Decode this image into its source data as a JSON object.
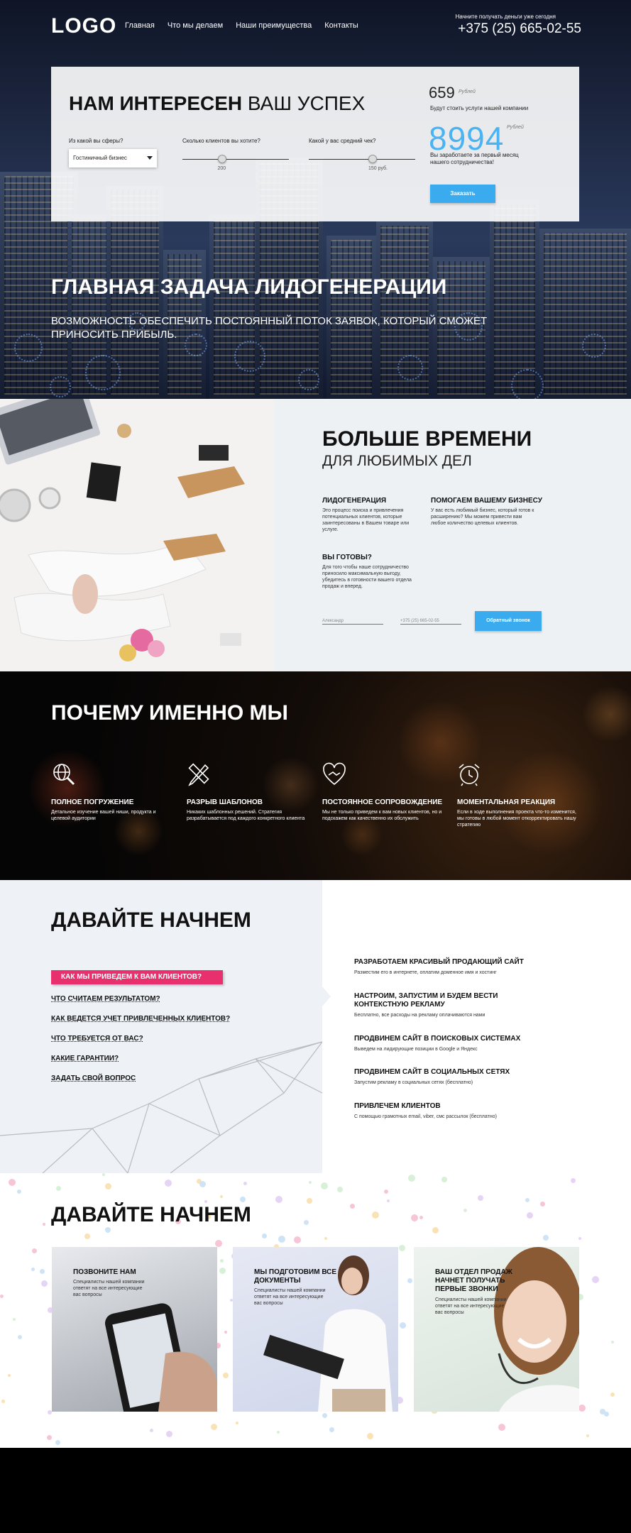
{
  "nav": {
    "logo": "LOGO",
    "links": [
      "Главная",
      "Что мы делаем",
      "Наши преимущества",
      "Контакты"
    ],
    "call_note": "Начните получать деньги уже сегодня",
    "phone": "+375 (25) 665-02-55"
  },
  "calculator": {
    "title_bold": "НАМ ИНТЕРЕСЕН",
    "title_light": "ВАШ УСПЕХ",
    "sphere_label": "Из какой вы сферы?",
    "sphere_value": "Гостиничный бизнес",
    "clients_label": "Сколько клиентов вы хотите?",
    "clients_value": "200",
    "clients_level": 0.37,
    "check_label": "Какой у вас средний чек?",
    "check_value": "150 руб.",
    "check_level": 0.6,
    "price": "659",
    "price_unit": "Рублей",
    "price_caption": "Будут стоить услуги нашей компании",
    "earn": "8994",
    "earn_unit": "Рублей",
    "earn_caption_1": "Вы заработаете за первый месяц",
    "earn_caption_2": "нашего сотрудничества!",
    "order_button": "Заказать"
  },
  "hero": {
    "heading": "ГЛАВНАЯ ЗАДАЧА ЛИДОГЕНЕРАЦИИ",
    "subheading": "ВОЗМОЖНОСТЬ ОБЕСПЕЧИТЬ ПОСТОЯННЫЙ ПОТОК ЗАЯВОК, КОТОРЫЙ СМОЖЕТ ПРИНОСИТЬ ПРИБЫЛЬ."
  },
  "more_time": {
    "heading": "БОЛЬШЕ ВРЕМЕНИ",
    "subheading": "ДЛЯ ЛЮБИМЫХ ДЕЛ",
    "items": [
      {
        "title": "ЛИДОГЕНЕРАЦИЯ",
        "text": "Это процесс поиска и привлечения потенциальных клиентов, которые заинтересованы в Вашем товаре или услуге."
      },
      {
        "title": "ПОМОГАЕМ ВАШЕМУ БИЗНЕСУ",
        "text": "У вас есть любимый бизнес, который готов к расширению? Мы можем привести вам любое количество целевых клиентов."
      },
      {
        "title": "ВЫ ГОТОВЫ?",
        "text": "Для того чтобы наше сотрудничество приносило максимальную выгоду, убедитесь в готовности вашего отдела продаж и вперед."
      }
    ],
    "name_placeholder": "Александр",
    "phone_placeholder": "+375 (25) 665-02-55",
    "callback_button": "Обратный звонок"
  },
  "why_us": {
    "heading_bold": "ПОЧЕМУ",
    "heading_light": "ИМЕННО МЫ",
    "features": [
      {
        "icon": "search-globe-icon",
        "title": "ПОЛНОЕ ПОГРУЖЕНИЕ",
        "text": "Детальное изучение вашей ниши, продукта и целевой аудитории"
      },
      {
        "icon": "pencil-ruler-icon",
        "title": "РАЗРЫВ ШАБЛОНОВ",
        "text": "Никаких шаблонных решений. Стратегия разрабатывается под каждого конкретного клиента"
      },
      {
        "icon": "heart-handshake-icon",
        "title": "ПОСТОЯННОЕ СОПРОВОЖДЕНИЕ",
        "text": "Мы не только приведем к вам новых клиентов, но и подскажем как качественно их обслужить"
      },
      {
        "icon": "alarm-clock-icon",
        "title": "МОМЕНТАЛЬНАЯ РЕАКЦИЯ",
        "text": "Если в ходе выполнения проекта что-то изменится, мы готовы в любой момент откорректировать нашу стратегию"
      }
    ]
  },
  "lets_start": {
    "heading_bold": "ДАВАЙТЕ",
    "heading_light": "НАЧНЕМ",
    "active_question": "КАК МЫ ПРИВЕДЕМ К ВАМ КЛИЕНТОВ?",
    "questions": [
      "ЧТО СЧИТАЕМ РЕЗУЛЬТАТОМ?",
      "КАК ВЕДЕТСЯ УЧЕТ ПРИВЛЕЧЕННЫХ КЛИЕНТОВ?",
      "ЧТО ТРЕБУЕТСЯ ОТ ВАС?",
      "КАКИЕ ГАРАНТИИ?",
      "ЗАДАТЬ СВОЙ ВОПРОС"
    ],
    "services": [
      {
        "title": "РАЗРАБОТАЕМ КРАСИВЫЙ ПРОДАЮЩИЙ САЙТ",
        "text": "Разместим его в интернете, оплатим доменное имя и хостинг"
      },
      {
        "title": "НАСТРОИМ, ЗАПУСТИМ И БУДЕМ ВЕСТИ КОНТЕКСТНУЮ РЕКЛАМУ",
        "text": "Бесплатно, все расходы на рекламу оплачиваются нами"
      },
      {
        "title": "ПРОДВИНЕМ САЙТ В ПОИСКОВЫХ СИСТЕМАХ",
        "text": "Выведем на лидирующие позиции в Google и Яндекс"
      },
      {
        "title": "ПРОДВИНЕМ САЙТ В СОЦИАЛЬНЫХ СЕТЯХ",
        "text": "Запустим рекламу в социальных сетях (бесплатно)"
      },
      {
        "title": "ПРИВЛЕЧЕМ КЛИЕНТОВ",
        "text": "С помощью грамотных email, viber, смс рассылок (бесплатно)"
      }
    ]
  },
  "steps": {
    "heading_bold": "ДАВАЙТЕ",
    "heading_light": "НАЧНЕМ",
    "cards": [
      {
        "title": "ПОЗВОНИТЕ НАМ",
        "text": "Специалисты нашей компании ответят на все интересующие вас вопросы"
      },
      {
        "title": "МЫ ПОДГОТОВИМ ВСЕ ДОКУМЕНТЫ",
        "text": "Специалисты нашей компании ответят на все интересующие вас вопросы"
      },
      {
        "title": "ВАШ ОТДЕЛ ПРОДАЖ НАЧНЕТ ПОЛУЧАТЬ ПЕРВЫЕ ЗВОНКИ",
        "text": "Специалисты нашей компании ответят на все интересующие вас вопросы"
      }
    ]
  },
  "colors": {
    "accent_blue": "#3aabee",
    "accent_pink": "#e8306e",
    "dark": "#111111"
  }
}
